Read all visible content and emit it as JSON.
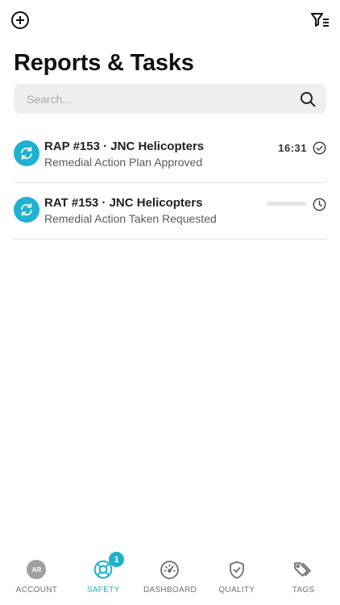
{
  "header": {
    "add_icon": "plus-circle-icon",
    "filter_icon": "filter-list-icon",
    "title": "Reports & Tasks"
  },
  "search": {
    "placeholder": "Search...",
    "value": "",
    "icon": "search-icon"
  },
  "items": [
    {
      "icon": "sync-icon",
      "title": "RAP #153 · JNC Helicopters",
      "subtitle": "Remedial Action Plan Approved",
      "time": "16:31",
      "status_icon": "check-circle-icon"
    },
    {
      "icon": "sync-icon",
      "title": "RAT #153 · JNC Helicopters",
      "subtitle": "Remedial Action Taken Requested",
      "time": "",
      "status_icon": "clock-icon"
    }
  ],
  "tabs": [
    {
      "label": "ACCOUNT",
      "icon": "avatar",
      "avatar_initials": "AR",
      "active": false
    },
    {
      "label": "SAFETY",
      "icon": "lifebuoy-icon",
      "badge": "1",
      "active": true
    },
    {
      "label": "DASHBOARD",
      "icon": "gauge-icon",
      "active": false
    },
    {
      "label": "QUALITY",
      "icon": "shield-check-icon",
      "active": false
    },
    {
      "label": "TAGS",
      "icon": "tags-icon",
      "active": false
    }
  ],
  "colors": {
    "accent": "#1fb2d0",
    "text_primary": "#222222",
    "text_secondary": "#5a5a5a",
    "search_bg": "#efefef",
    "divider": "#e2e2e2"
  }
}
